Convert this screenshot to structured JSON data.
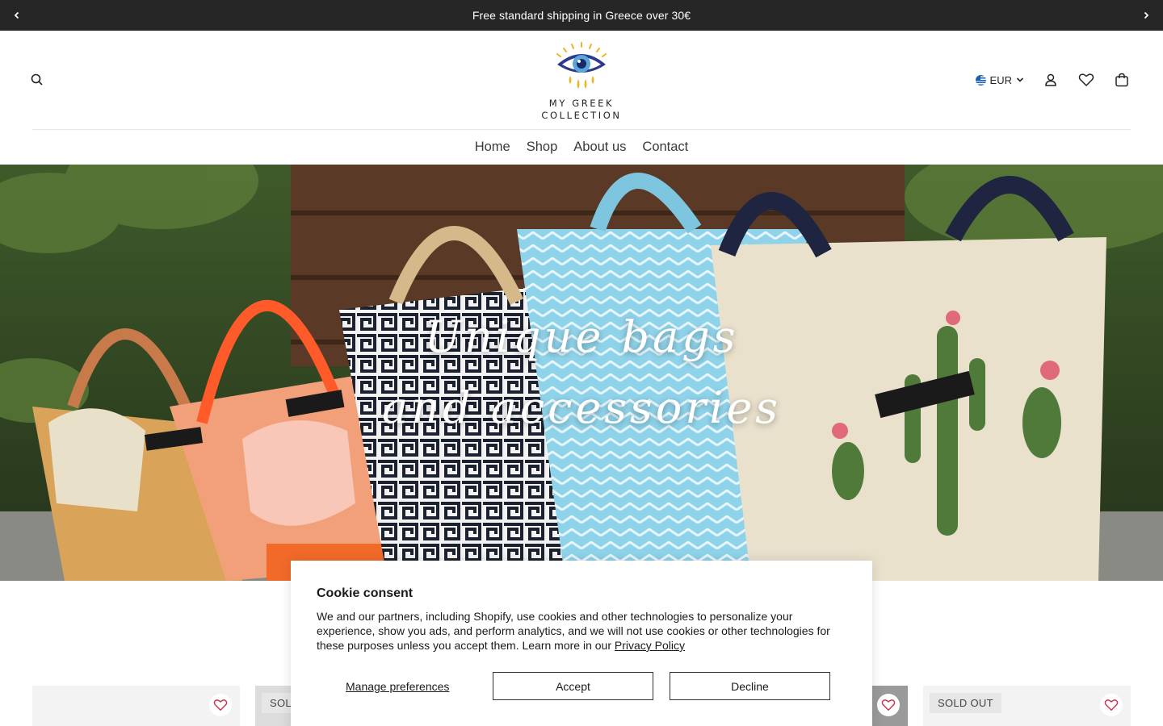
{
  "announcement": {
    "message": "Free standard shipping in Greece over 30€",
    "prev_icon": "chevron-left-icon",
    "next_icon": "chevron-right-icon"
  },
  "header": {
    "logo_line1": "MY GREEK",
    "logo_line2": "COLLECTION",
    "currency": "EUR",
    "icons": [
      "search-icon",
      "flag-greece-icon",
      "chevron-down-icon",
      "account-icon",
      "heart-icon",
      "bag-icon"
    ]
  },
  "nav": {
    "items": [
      "Home",
      "Shop",
      "About us",
      "Contact"
    ]
  },
  "hero": {
    "line1": "Unique bags",
    "line2": "and accessories"
  },
  "products": {
    "sold_out_label_partial": "SOL",
    "sold_out_label": "SOLD OUT"
  },
  "cookie": {
    "title": "Cookie consent",
    "body": "We and our partners, including Shopify, use cookies and other technologies to personalize your experience, show you ads, and perform analytics, and we will not use cookies or other technologies for these purposes unless you accept them. Learn more in our ",
    "privacy_link": "Privacy Policy",
    "manage": "Manage preferences",
    "accept": "Accept",
    "decline": "Decline"
  },
  "colors": {
    "announcement_bg": "#262626",
    "logo_blue": "#2b3a8c",
    "logo_gold": "#f0b323"
  }
}
